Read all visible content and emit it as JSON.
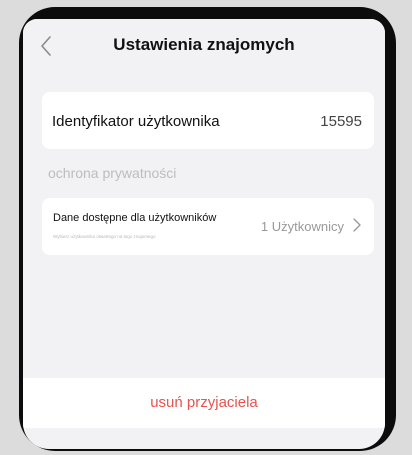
{
  "header": {
    "title": "Ustawienia znajomych",
    "back_icon": "chevron-left-icon"
  },
  "user_id": {
    "label": "Identyfikator użytkownika",
    "value": "15595"
  },
  "privacy": {
    "section_title": "ochrona prywatności",
    "item_title": "Dane dostępne dla użytkowników",
    "item_subtitle": "Wybierz użytkownika otwartego na tego znajomego",
    "item_value": "1 Użytkownicy",
    "chevron_icon": "chevron-right-icon"
  },
  "actions": {
    "delete_label": "usuń przyjaciela",
    "delete_color": "#e8524f"
  }
}
